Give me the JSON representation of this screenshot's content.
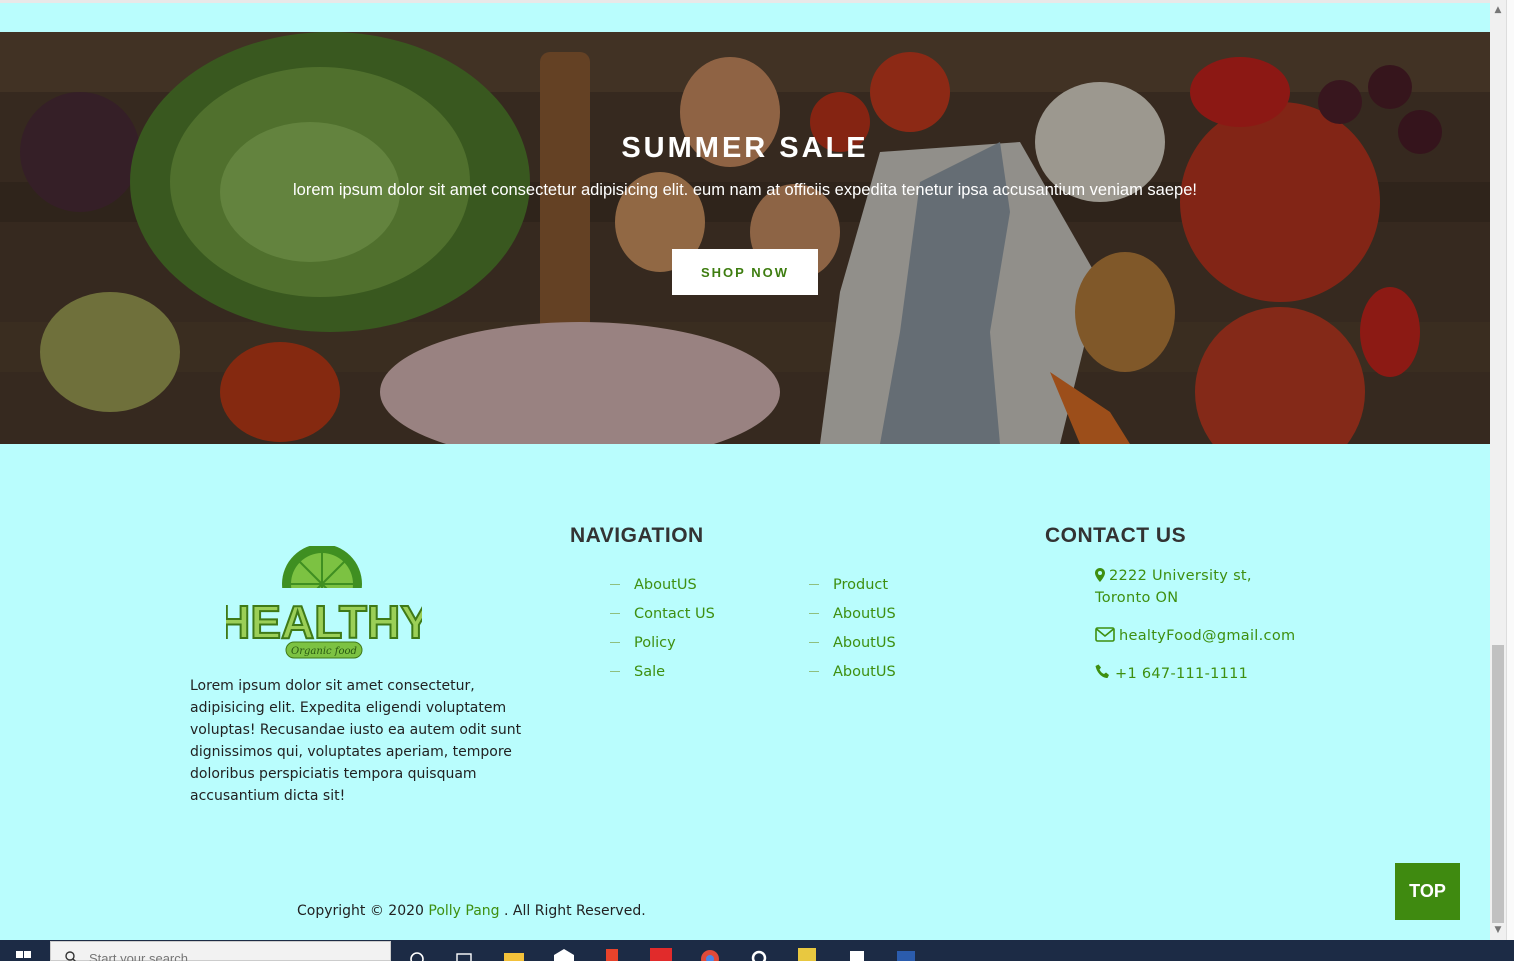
{
  "hero": {
    "title": "SUMMER SALE",
    "text": "lorem ipsum dolor sit amet consectetur adipisicing elit. eum nam at officiis expedita tenetur ipsa accusantium veniam saepe!",
    "button": "SHOP NOW"
  },
  "footer": {
    "logo": {
      "word": "HEALTHY",
      "tagline": "Organic food"
    },
    "about": "Lorem ipsum dolor sit amet consectetur, adipisicing elit. Expedita eligendi voluptatem voluptas! Recusandae iusto ea autem odit sunt dignissimos qui, voluptates aperiam, tempore doloribus perspiciatis tempora quisquam accusantium dicta sit!",
    "navigation": {
      "title": "NAVIGATION",
      "col1": [
        "AboutUS",
        "Contact US",
        "Policy",
        "Sale"
      ],
      "col2": [
        "Product",
        "AboutUS",
        "AboutUS",
        "AboutUS"
      ]
    },
    "contact": {
      "title": "CONTACT US",
      "address": "2222 University st, Toronto ON",
      "email": "healtyFood@gmail.com",
      "phone": "+1 647-111-1111"
    },
    "copyright": {
      "prefix": "Copyright © 2020",
      "author": "Polly Pang",
      "suffix": ". All Right Reserved."
    },
    "top_button": "TOP"
  },
  "taskbar": {
    "search_placeholder": "Start your search",
    "apps": [
      "cortana-icon",
      "task-view-icon",
      "file-explorer-icon",
      "mail-icon",
      "office-icon",
      "youdao-icon",
      "chrome-icon",
      "settings-icon",
      "sticky-notes-icon",
      "teams-icon",
      "word-icon"
    ]
  },
  "colors": {
    "background": "#b9fdfd",
    "accent_green": "#3e8f10",
    "top_button": "#3f8a10"
  }
}
